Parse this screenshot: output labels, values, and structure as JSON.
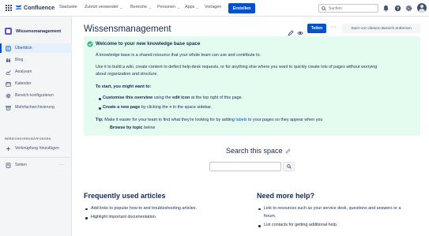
{
  "app": {
    "name": "Confluence",
    "nav": [
      {
        "label": "Startseite",
        "dropdown": false
      },
      {
        "label": "Zuletzt verwendet",
        "dropdown": true
      },
      {
        "label": "Bereiche",
        "dropdown": true
      },
      {
        "label": "Personen",
        "dropdown": true
      },
      {
        "label": "Apps",
        "dropdown": true
      },
      {
        "label": "Vorlagen",
        "dropdown": false
      }
    ],
    "create_label": "Erstellen",
    "search_placeholder": "Suchen",
    "caret": "⌄",
    "accent": "#0052cc"
  },
  "sidebar": {
    "space_name": "Wissensmanagement",
    "items": [
      {
        "label": "Überblick",
        "icon": "overview-icon",
        "active": true
      },
      {
        "label": "Blog",
        "icon": "quote-icon"
      },
      {
        "label": "Analysen",
        "icon": "chart-icon"
      },
      {
        "label": "Kalender",
        "icon": "calendar-icon"
      },
      {
        "label": "Bereich konfigurieren",
        "icon": "gear-icon"
      },
      {
        "label": "Mehrfacharchivierung",
        "icon": "archive-icon"
      }
    ],
    "section_label": "BEREICHSVERKNÜPFUNGEN",
    "add_shortcut": "Verknüpfung hinzufügen",
    "pages_label": "Seiten",
    "more": "···"
  },
  "page": {
    "title": "Wissensmanagement",
    "share_label": "Teilen",
    "more": "···",
    "unstar_label": "Stern von diesem Bereich entfernen",
    "panel": {
      "title": "Welcome to your new knowledge base space",
      "p1": "A knowledge base is a shared resource that your whole team can use and contribute to.",
      "p2_line1": "Use it to build a wiki, create content to deflect help-desk requests, or for anything else where you want to quickly create lots of pages without worrying",
      "p2_line2": "about organization and structure.",
      "start_title": "To start, you might want to:",
      "li1_b1": "Customise this overview",
      "li1_t1": " using the ",
      "li1_b2": "edit icon",
      "li1_t2": " at the top right of this page.",
      "li2_b1": "Create a new page",
      "li2_t1": " by clicking the ",
      "li2_b2": "+",
      "li2_t2": " in the space sidebar.",
      "tip_b": "Tip:",
      "tip_t1": " Make it easier for your team to find what they're looking for by adding ",
      "tip_link": "labels",
      "tip_t2": " to your pages so they appear when you",
      "tip_line2_b": "Browse by topic",
      "tip_line2_t": " below"
    },
    "search_title": "Search this space",
    "frequent": {
      "title": "Frequently used articles",
      "items": [
        "Add links to popular how-to and troubleshooting articles.",
        "Highlight important documentation."
      ]
    },
    "help": {
      "title": "Need more help?",
      "item1_line1": "Link to resources such as your service desk, questions and answers or a",
      "item1_line2": "forum.",
      "item2": "List contacts for getting additional help."
    }
  }
}
